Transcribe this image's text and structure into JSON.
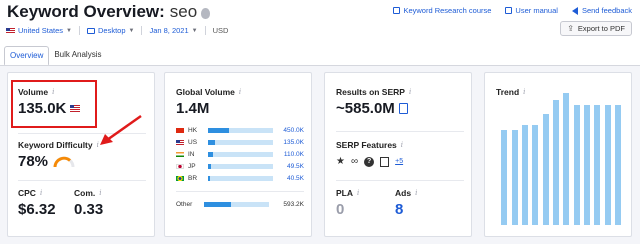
{
  "header": {
    "title": "Keyword Overview:",
    "keyword": "seo",
    "filters": {
      "database": "United States",
      "device": "Desktop",
      "date": "Jan 8, 2021",
      "currency": "USD"
    },
    "links": {
      "course": "Keyword Research course",
      "manual": "User manual",
      "feedback": "Send feedback"
    },
    "export_label": "Export to PDF",
    "tabs": [
      "Overview",
      "Bulk Analysis"
    ]
  },
  "volume": {
    "label": "Volume",
    "value": "135.0K"
  },
  "difficulty": {
    "label": "Keyword Difficulty",
    "value": "78%",
    "color": "#f58a07"
  },
  "cpc": {
    "label": "CPC",
    "value": "$6.32"
  },
  "competition": {
    "label": "Com.",
    "value": "0.33"
  },
  "global_volume": {
    "label": "Global Volume",
    "value": "1.4M",
    "rows": [
      {
        "code": "HK",
        "value": "450.0K",
        "share": 0.32
      },
      {
        "code": "US",
        "value": "135.0K",
        "share": 0.1
      },
      {
        "code": "IN",
        "value": "110.0K",
        "share": 0.08
      },
      {
        "code": "JP",
        "value": "49.5K",
        "share": 0.04
      },
      {
        "code": "BR",
        "value": "40.5K",
        "share": 0.03
      },
      {
        "code": "Other",
        "value": "593.2K",
        "share": 0.42
      }
    ]
  },
  "results": {
    "label": "Results on SERP",
    "value": "~585.0M"
  },
  "serp_features": {
    "label": "SERP Features",
    "more": "+5"
  },
  "pla": {
    "label": "PLA",
    "value": "0"
  },
  "ads": {
    "label": "Ads",
    "value": "8"
  },
  "trend": {
    "label": "Trend",
    "values": [
      0.72,
      0.72,
      0.76,
      0.76,
      0.84,
      0.95,
      1.0,
      0.91,
      0.91,
      0.91,
      0.91,
      0.91
    ]
  }
}
